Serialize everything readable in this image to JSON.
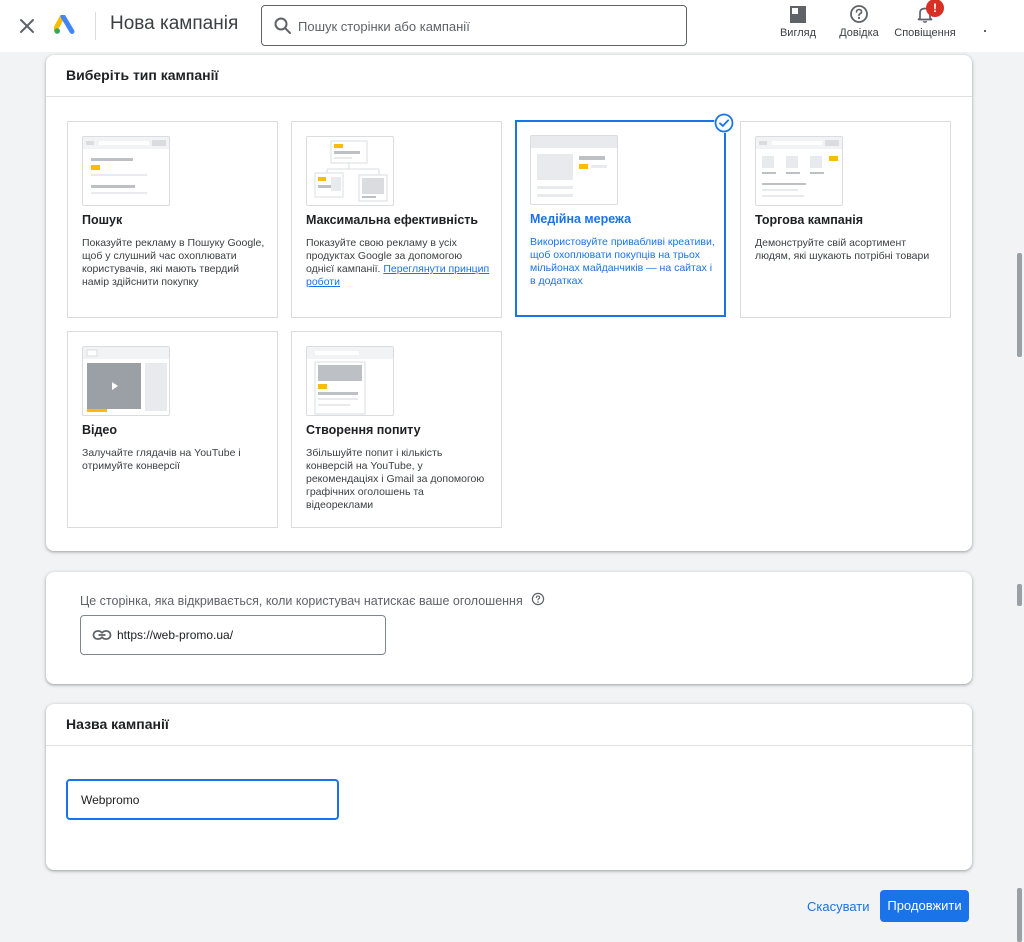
{
  "header": {
    "title": "Нова кампанія",
    "search_placeholder": "Пошук сторінки або кампанії",
    "view_label": "Вигляд",
    "help_label": "Довідка",
    "notifications_label": "Сповіщення",
    "notifications_badge": "!"
  },
  "campaign_type": {
    "heading": "Виберіть тип кампанії",
    "tiles": [
      {
        "title": "Пошук",
        "desc": "Показуйте рекламу в Пошуку Google, щоб у слушний час охоплювати користувачів, які мають твердий намір здійснити покупку"
      },
      {
        "title": "Максимальна ефективність",
        "desc": "Показуйте свою рекламу в усіх продуктах Google за допомогою однієї кампанії.",
        "link": "Переглянути принцип роботи"
      },
      {
        "title": "Медійна мережа",
        "desc": "Використовуйте привабливі креативи, щоб охоплювати покупців на трьох мільйонах майданчиків — на сайтах і в додатках",
        "selected": true
      },
      {
        "title": "Торгова кампанія",
        "desc": "Демонструйте свій асортимент людям, які шукають потрібні товари"
      },
      {
        "title": "Відео",
        "desc": "Залучайте глядачів на YouTube і отримуйте конверсії"
      },
      {
        "title": "Створення попиту",
        "desc": "Збільшуйте попит і кількість конверсій на YouTube, у рекомендаціях і Gmail за допомогою графічних оголошень та відеореклами"
      }
    ]
  },
  "landing_page": {
    "label": "Це сторінка, яка відкривається, коли користувач натискає ваше оголошення",
    "url_value": "https://web-promo.ua/"
  },
  "campaign_name": {
    "heading": "Назва кампанії",
    "value": "Webpromo"
  },
  "actions": {
    "cancel": "Скасувати",
    "continue": "Продовжити"
  },
  "colors": {
    "accent": "#1a73e8",
    "thumb_yellow": "#fbbc04",
    "badge_red": "#d93025"
  }
}
